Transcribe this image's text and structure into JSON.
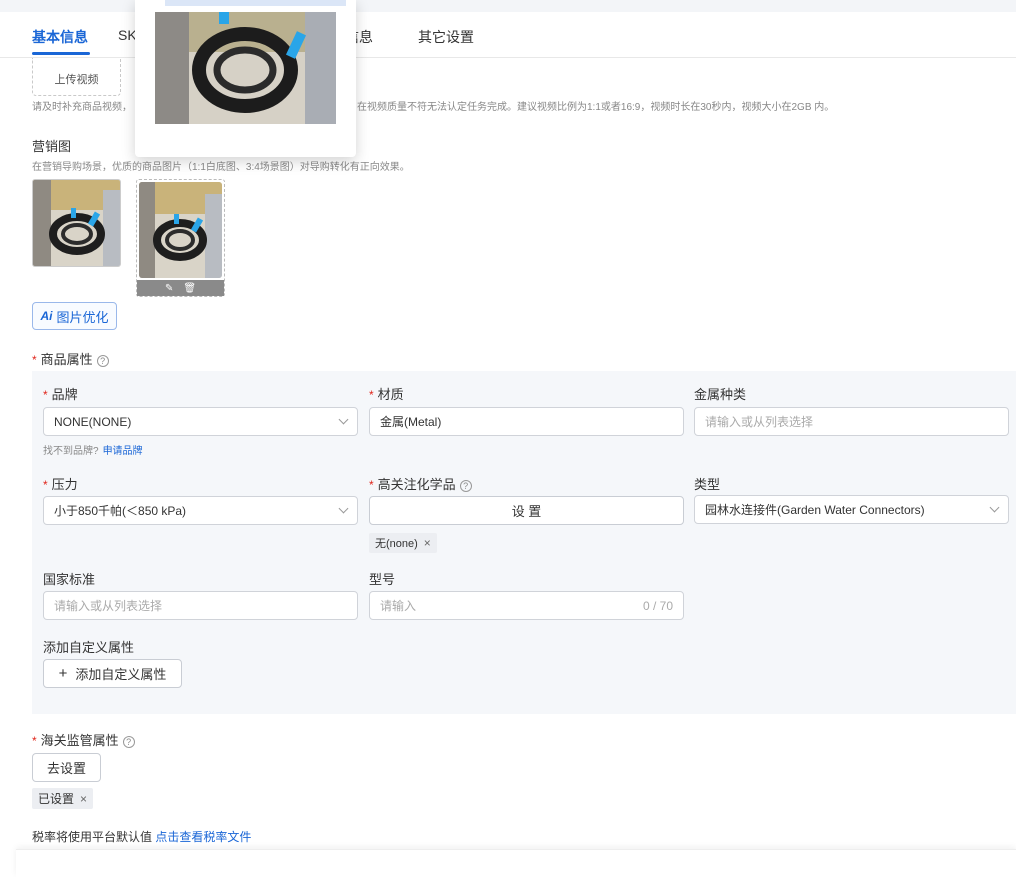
{
  "tabs": [
    {
      "label": "基本信息",
      "active": true
    },
    {
      "label": "SK",
      "active": false
    },
    {
      "label": "包信息",
      "active": false
    },
    {
      "label": "其它设置",
      "active": false
    }
  ],
  "video": {
    "upload_label": "上传视频",
    "hint_a": "请及时补充商品视频，",
    "hint_b": "在视频质量不符无法认定任务完成。建议视频比例为1:1或者16:9，视频时长在30秒内，视频大小在2GB 内。"
  },
  "marketing": {
    "title": "营销图",
    "hint": "在营销导购场景，优质的商品图片（1:1白底图、3:4场景图）对导购转化有正向效果。",
    "edit_icon": "pencil-icon",
    "delete_icon": "trash-icon"
  },
  "ai_button": {
    "mark": "Ai",
    "label": "图片优化"
  },
  "attributes": {
    "title": "商品属性",
    "brand": {
      "label": "品牌",
      "value": "NONE(NONE)",
      "hint": "找不到品牌?",
      "hint_link": "申请品牌"
    },
    "material": {
      "label": "材质",
      "value": "金属(Metal)"
    },
    "metal_type": {
      "label": "金属种类",
      "placeholder": "请输入或从列表选择"
    },
    "pressure": {
      "label": "压力",
      "value": "小于850千帕(＜850 kPa)"
    },
    "chemicals": {
      "label": "高关注化学品",
      "button": "设 置",
      "tag": "无(none)"
    },
    "type": {
      "label": "类型",
      "value": "园林水连接件(Garden Water Connectors)"
    },
    "national_std": {
      "label": "国家标准",
      "placeholder": "请输入或从列表选择"
    },
    "model": {
      "label": "型号",
      "placeholder": "请输入",
      "counter": "0 / 70"
    },
    "custom": {
      "label": "添加自定义属性",
      "button": "添加自定义属性"
    }
  },
  "customs": {
    "title": "海关监管属性",
    "button": "去设置",
    "tag": "已设置"
  },
  "tax": {
    "text": "税率将使用平台默认值",
    "link": "点击查看税率文件"
  },
  "colors": {
    "accent": "#1a66d6",
    "required": "#e0251b"
  }
}
